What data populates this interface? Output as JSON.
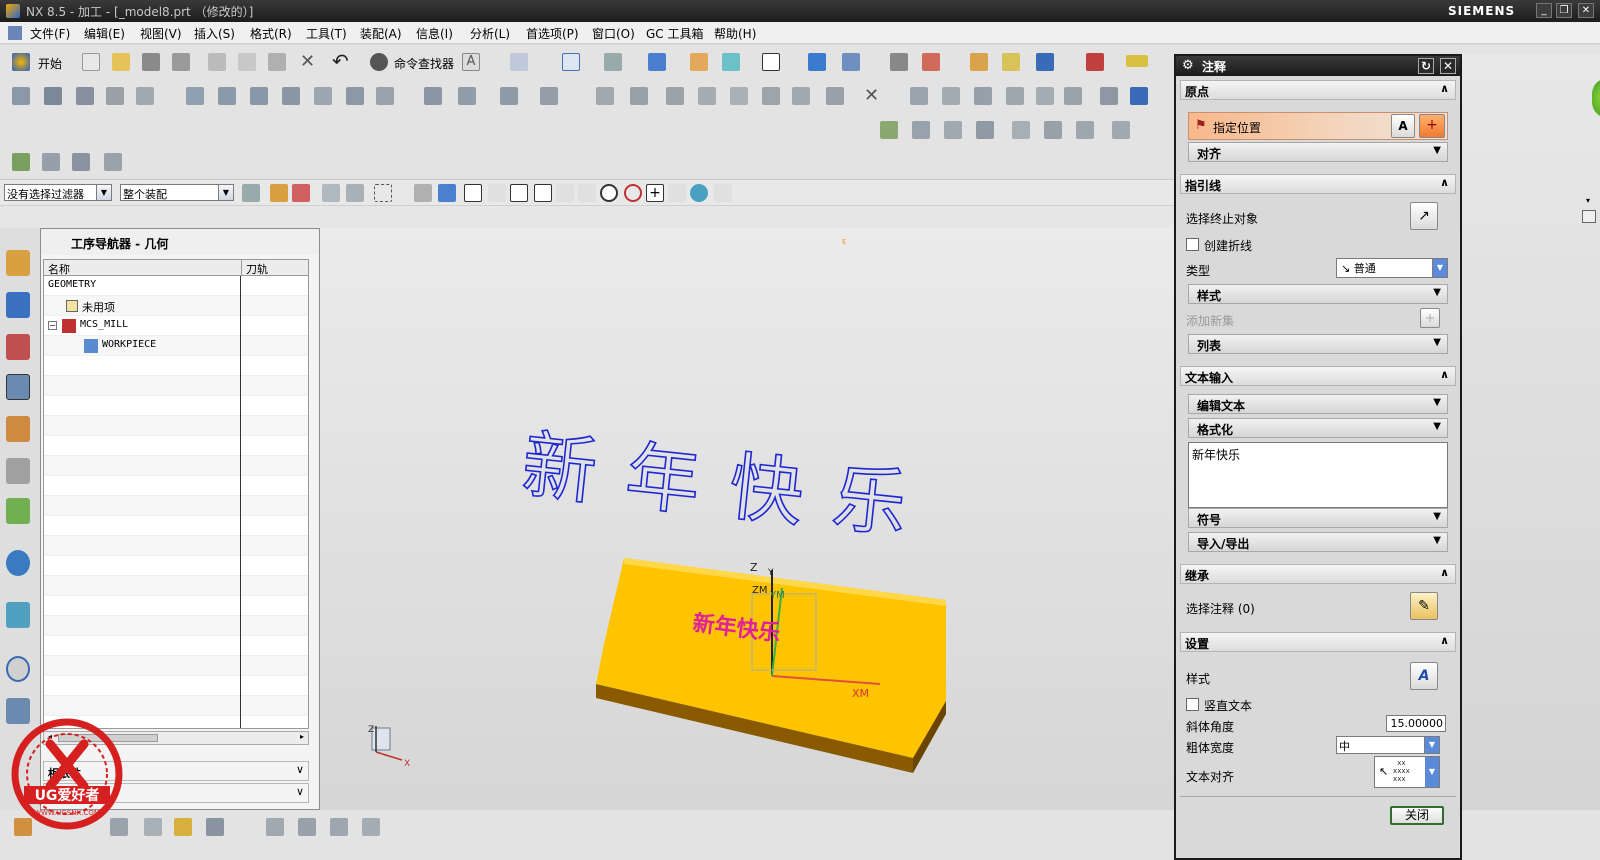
{
  "window": {
    "title": "NX 8.5 - 加工 - [_model8.prt （修改的）]",
    "brand": "SIEMENS"
  },
  "menu": [
    "文件(F)",
    "编辑(E)",
    "视图(V)",
    "插入(S)",
    "格式(R)",
    "工具(T)",
    "装配(A)",
    "信息(I)",
    "分析(L)",
    "首选项(P)",
    "窗口(O)",
    "GC 工具箱",
    "帮助(H)"
  ],
  "toolbar": {
    "start_label": "开始",
    "command_finder_label": "命令查找器"
  },
  "filters": {
    "selection_filter": "没有选择过滤器",
    "scope": "整个装配"
  },
  "navigator": {
    "title": "工序导航器 - 几何",
    "columns": [
      "名称",
      "刀轨"
    ],
    "rows": [
      "GEOMETRY",
      "未用项",
      "MCS_MILL",
      "WORKPIECE"
    ],
    "panels": [
      "相依性",
      "细节"
    ]
  },
  "viewport": {
    "annotation_text": "新年快乐",
    "embossed_text": "新年快乐",
    "axis_labels": {
      "z": "Z",
      "y": "Y",
      "zm": "ZM",
      "ym": "YM",
      "xm": "XM"
    },
    "triad_labels": {
      "z": "Z",
      "x": "X"
    },
    "colors": {
      "block_top": "#ffc400",
      "block_side": "#8a5a00",
      "annotation": "#1e28d2",
      "emboss": "#e0209a"
    }
  },
  "dialog": {
    "title": "注释",
    "sections": {
      "origin": {
        "header": "原点",
        "specify_position": "指定位置",
        "align": "对齐"
      },
      "leader": {
        "header": "指引线",
        "select_terminating": "选择终止对象",
        "create_jog": "创建折线",
        "type_label": "类型",
        "type_value": "普通",
        "style": "样式",
        "add_new_set": "添加新集",
        "list": "列表"
      },
      "text_input": {
        "header": "文本输入",
        "edit_text": "编辑文本",
        "formatting": "格式化",
        "text_value": "新年快乐",
        "symbols": "符号",
        "import_export": "导入/导出"
      },
      "inherit": {
        "header": "继承",
        "select_annotation": "选择注释 (0)"
      },
      "settings": {
        "header": "设置",
        "style": "样式",
        "vertical_text": "竖直文本",
        "italic_angle": "斜体角度",
        "italic_angle_value": "15.00000",
        "bold_width": "粗体宽度",
        "bold_width_value": "中",
        "text_alignment": "文本对齐"
      }
    },
    "close_label": "关闭"
  },
  "watermark": {
    "text": "UG爱好者",
    "url": "WWW.UGSNX.COM"
  }
}
